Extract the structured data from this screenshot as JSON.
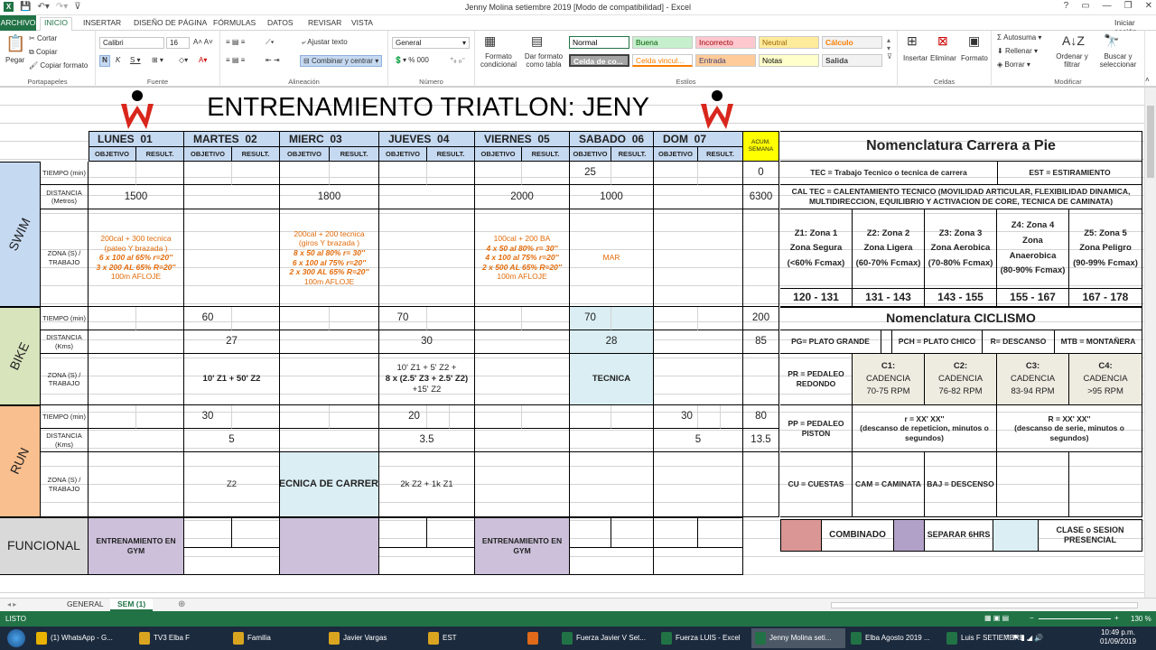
{
  "window": {
    "title": "Jenny Molina setiembre 2019  [Modo de compatibilidad] - Excel",
    "signin": "Iniciar sesión",
    "controls": [
      "?",
      "▭",
      "—",
      "❐",
      "✕"
    ]
  },
  "menu": [
    "ARCHIVO",
    "INICIO",
    "INSERTAR",
    "DISEÑO DE PÁGINA",
    "FÓRMULAS",
    "DATOS",
    "REVISAR",
    "VISTA"
  ],
  "ribbon": {
    "paste": "Pegar",
    "cut": "Cortar",
    "copy": "Copiar",
    "copy_format": "Copiar formato",
    "font_name": "Calibri",
    "font_size": "16",
    "wrap_text": "Ajustar texto",
    "merge_center": "Combinar y centrar",
    "number_format": "General",
    "cond_format": "Formato condicional",
    "format_table": "Dar formato como tabla",
    "insert": "Insertar",
    "delete": "Eliminar",
    "format": "Formato",
    "autosum": "Autosuma",
    "fill": "Rellenar",
    "clear": "Borrar",
    "sort_filter": "Ordenar y filtrar",
    "find_select": "Buscar y seleccionar",
    "groups": [
      "Portapapeles",
      "Fuente",
      "Alineación",
      "Número",
      "Estilos",
      "Celdas",
      "Modificar"
    ],
    "styles": [
      {
        "label": "Normal",
        "bg": "#ffffff",
        "color": "#000000"
      },
      {
        "label": "Buena",
        "bg": "#c6efce",
        "color": "#006100"
      },
      {
        "label": "Incorrecto",
        "bg": "#ffc7ce",
        "color": "#9c0006"
      },
      {
        "label": "Neutral",
        "bg": "#ffeb9c",
        "color": "#9c6500"
      },
      {
        "label": "Cálculo",
        "bg": "#f2f2f2",
        "color": "#fa7d00"
      },
      {
        "label": "Celda de co...",
        "bg": "#a5a5a5",
        "color": "#ffffff"
      },
      {
        "label": "Celda vincul...",
        "bg": "#ffffff",
        "color": "#fa7d00"
      },
      {
        "label": "Entrada",
        "bg": "#ffcc99",
        "color": "#3f3f76"
      },
      {
        "label": "Notas",
        "bg": "#ffffcc",
        "color": "#000000"
      },
      {
        "label": "Salida",
        "bg": "#f2f2f2",
        "color": "#3f3f3f"
      }
    ]
  },
  "sheet": {
    "title": "ENTRENAMIENTO TRIATLON: JENY",
    "days": [
      {
        "name": "LUNES",
        "num": "01"
      },
      {
        "name": "MARTES",
        "num": "02"
      },
      {
        "name": "MIERC",
        "num": "03"
      },
      {
        "name": "JUEVES",
        "num": "04"
      },
      {
        "name": "VIERNES",
        "num": "05"
      },
      {
        "name": "SABADO",
        "num": "06"
      },
      {
        "name": "DOM",
        "num": "07"
      }
    ],
    "objetivo": "OBJETIVO",
    "result": "RESULT.",
    "acum": "ACUM. SEMANA",
    "row_labels": {
      "tiempo": "TIEMPO (min)",
      "distancia_m": "DISTANCIA (Metros)",
      "distancia_k": "DISTANCIA (Kms)",
      "zona": "ZONA (S) / TRABAJO"
    },
    "sports": {
      "swim": "SWIM",
      "bike": "BIKE",
      "run": "RUN",
      "funcional": "FUNCIONAL"
    },
    "swim": {
      "tiempo_sab": "25",
      "tiempo_acum": "0",
      "dist": [
        "1500",
        "1800",
        "2000",
        "1000"
      ],
      "dist_acum": "6300",
      "zona_lun": [
        "200cal + 300 tecnica",
        "(pateo Y brazada )",
        "6 x 100 al 65% r=20''",
        "3 x 200  AL 65% R=20''",
        "100m AFLOJE"
      ],
      "zona_mie": [
        "200cal + 200 tecnica",
        "(giros Y brazada )",
        "8 x 50 al 80% r= 30''",
        "6 x 100 al 75% r=20''",
        "2 x 300  AL 65% R=20''",
        "100m AFLOJE"
      ],
      "zona_vie": [
        "100cal + 200 BA",
        "4 x 50 al 80% r= 30''",
        "4 x 100 al 75% r=20''",
        "2 x 500  AL 65% R=20''",
        "100m AFLOJE"
      ],
      "zona_sab": "MAR"
    },
    "bike": {
      "tiempo": [
        "60",
        "70",
        "70"
      ],
      "tiempo_acum": "200",
      "dist": [
        "27",
        "30",
        "28"
      ],
      "dist_acum": "85",
      "zona_mar": "10' Z1 + 50' Z2",
      "zona_jue": [
        "10' Z1 + 5' Z2 +",
        "8 x (2.5' Z3 + 2.5' Z2)",
        "+15' Z2"
      ],
      "zona_sab": "TECNICA"
    },
    "run": {
      "tiempo": [
        "30",
        "20",
        "30"
      ],
      "tiempo_acum": "80",
      "dist": [
        "5",
        "3.5",
        "5"
      ],
      "dist_acum": "13.5",
      "zona_mar": "Z2",
      "zona_mie": "TECNICA DE CARRERA",
      "zona_jue": "2k Z2 + 1k Z1"
    },
    "funcional": {
      "gym": "ENTRENAMIENTO EN GYM"
    },
    "nomen_run": {
      "title": "Nomenclatura Carrera a Pie",
      "tec": "TEC = Trabajo Tecnico o tecnica de carrera",
      "est": "EST = ESTIRAMIENTO",
      "cal": "CAL TEC = CALENTAMIENTO TECNICO (MOVILIDAD ARTICULAR, FLEXIBILIDAD DINAMICA, MULTIDIRECCION, EQUILIBRIO Y ACTIVACION DE CORE, TECNICA DE CAMINATA)",
      "zones": [
        {
          "lines": [
            "Z1: Zona 1",
            "Zona Segura",
            "(<60% Fcmax)"
          ],
          "range": "120  -  131"
        },
        {
          "lines": [
            "Z2: Zona 2",
            "Zona Ligera",
            "(60-70% Fcmax)"
          ],
          "range": "131  -  143"
        },
        {
          "lines": [
            "Z3: Zona 3",
            "Zona Aerobica",
            "(70-80% Fcmax)"
          ],
          "range": "143  -  155"
        },
        {
          "lines": [
            "Z4: Zona 4",
            "Zona",
            "Anaerobica",
            "(80-90% Fcmax)"
          ],
          "range": "155  -  167"
        },
        {
          "lines": [
            "Z5: Zona 5",
            "Zona Peligro",
            "(90-99% Fcmax)"
          ],
          "range": "167  -  178"
        }
      ]
    },
    "nomen_bike": {
      "title": "Nomenclatura CICLISMO",
      "pg": "PG= PLATO GRANDE",
      "pch": "PCH = PLATO CHICO",
      "r": "R= DESCANSO",
      "mtb": "MTB = MONTAÑERA",
      "pr": "PR = PEDALEO REDONDO",
      "cad": [
        {
          "c": "C1:",
          "t": "CADENCIA",
          "v": "70-75 RPM"
        },
        {
          "c": "C2:",
          "t": "CADENCIA",
          "v": "76-82 RPM"
        },
        {
          "c": "C3:",
          "t": "CADENCIA",
          "v": "83-94 RPM"
        },
        {
          "c": "C4:",
          "t": "CADENCIA",
          "v": ">95 RPM"
        }
      ],
      "pp": "PP = PEDALEO PISTON",
      "rr": "r = XX' XX''",
      "rr2": "(descanso de repeticion, minutos o segundos)",
      "RR": "R = XX' XX''",
      "RR2": "(descanso de serie, minutos o segundos)",
      "cu": "CU = CUESTAS",
      "cam": "CAM = CAMINATA",
      "baj": "BAJ = DESCENSO"
    },
    "legend": {
      "combinado": "COMBINADO",
      "separar": "SEPARAR 6HRS",
      "clase": "CLASE o SESION PRESENCIAL",
      "c_combinado": "#da9694",
      "c_separar": "#b1a0c7",
      "c_clase": "#daeef3"
    },
    "colors": {
      "swim": "#c5d9f1",
      "bike": "#d8e4bc",
      "run": "#fabf8f",
      "funcional": "#d9d9d9",
      "gym": "#ccc0da",
      "acum": "#ffff00",
      "tecnica": "#daeef3",
      "cad": "#eeece1"
    }
  },
  "tabs": [
    "GENERAL",
    "SEM  (1)"
  ],
  "status": {
    "left": "LISTO",
    "zoom": "130 %"
  },
  "taskbar": {
    "items": [
      "(1) WhatsApp - G...",
      "TV3  Elba F",
      "Familia",
      "Javier Vargas",
      "EST",
      "",
      "Fuerza Javier V Set...",
      "Fuerza LUIS - Excel",
      "Jenny Molina seti...",
      "Elba Agosto 2019 ...",
      "Luis F SETIEMBRE ..."
    ],
    "time": "10:49 p.m.",
    "date": "01/09/2019"
  }
}
